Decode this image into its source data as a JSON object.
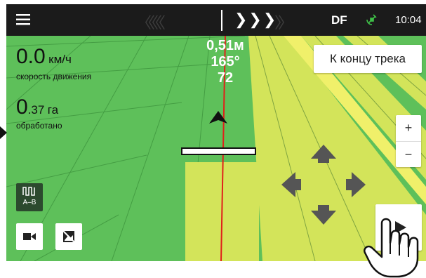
{
  "topbar": {
    "menu_icon": "hamburger-icon",
    "guidance_left": "〈〈〈〈〈",
    "guidance_right_active": "❯❯❯",
    "guidance_right_faded": "〉〉",
    "source": "DF",
    "gps_icon": "satellite-icon",
    "time": "10:04"
  },
  "overlay": {
    "deviation": "0,51м",
    "heading": "165°",
    "count": "72"
  },
  "metrics": {
    "speed_value": "0.0",
    "speed_unit": "км/ч",
    "speed_label": "скорость движения",
    "area_value": "0",
    "area_decimal": ".37",
    "area_unit": "га",
    "area_label": "обработано"
  },
  "buttons": {
    "to_track_end": "К концу трека",
    "zoom_in": "+",
    "zoom_out": "−",
    "ab_mode": "A–B",
    "camera_icon": "camera-icon",
    "no_photo_icon": "no-photo-icon",
    "play_icon": "play-icon"
  },
  "colors": {
    "field": "#5ec05a",
    "worked_strip": "#d3e45a",
    "guidance_line": "#e0201a",
    "topbar": "#1b1b1b"
  }
}
